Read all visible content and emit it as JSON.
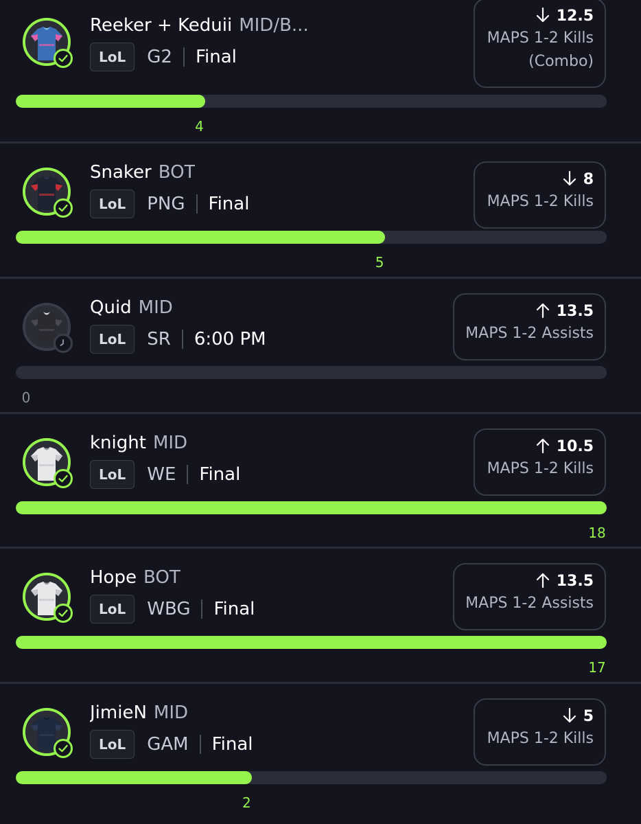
{
  "picks": [
    {
      "player": "Reeker + Keduii",
      "position": "MID/B...",
      "league": "LoL",
      "team": "G2",
      "status": "Final",
      "direction": "down",
      "line": "12.5",
      "stat": "MAPS 1-2 Kills\n(Combo)",
      "actual": "4",
      "progress": 0.32,
      "result": "check-icon",
      "jersey": "pink-blue-jersey"
    },
    {
      "player": "Snaker",
      "position": "BOT",
      "league": "LoL",
      "team": "PNG",
      "status": "Final",
      "direction": "down",
      "line": "8",
      "stat": "MAPS 1-2 Kills",
      "actual": "5",
      "progress": 0.625,
      "result": "check-icon",
      "jersey": "navy-red-jersey"
    },
    {
      "player": "Quid",
      "position": "MID",
      "league": "LoL",
      "team": "SR",
      "status": "6:00 PM",
      "direction": "up",
      "line": "13.5",
      "stat": "MAPS 1-2 Assists",
      "actual": "0",
      "progress": 0,
      "result": "clock-icon",
      "jersey": "black-camo-jersey"
    },
    {
      "player": "knight",
      "position": "MID",
      "league": "LoL",
      "team": "WE",
      "status": "Final",
      "direction": "up",
      "line": "10.5",
      "stat": "MAPS 1-2 Kills",
      "actual": "18",
      "progress": 1,
      "result": "check-icon",
      "jersey": "white-jersey"
    },
    {
      "player": "Hope",
      "position": "BOT",
      "league": "LoL",
      "team": "WBG",
      "status": "Final",
      "direction": "up",
      "line": "13.5",
      "stat": "MAPS 1-2 Assists",
      "actual": "17",
      "progress": 1,
      "result": "check-icon",
      "jersey": "white-jersey"
    },
    {
      "player": "JimieN",
      "position": "MID",
      "league": "LoL",
      "team": "GAM",
      "status": "Final",
      "direction": "down",
      "line": "5",
      "stat": "MAPS 1-2 Kills",
      "actual": "2",
      "progress": 0.4,
      "result": "check-icon",
      "jersey": "dark-navy-jersey"
    }
  ],
  "colors": {
    "accent": "#96f34e",
    "background": "#13141e",
    "track": "#2b2d3a",
    "muted": "#b3b5c2"
  }
}
